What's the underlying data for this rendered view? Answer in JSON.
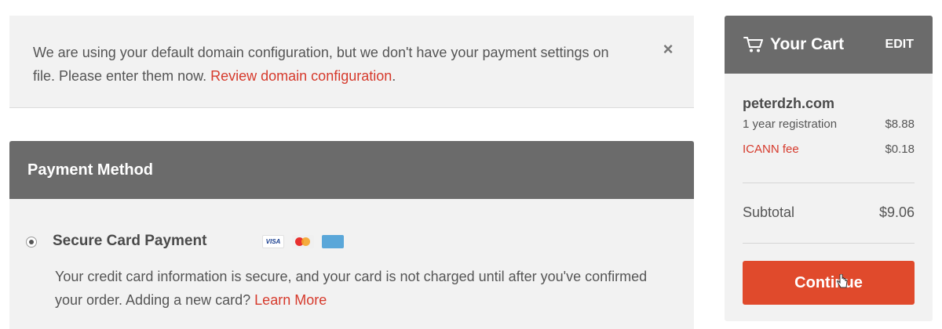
{
  "notice": {
    "text": "We are using your default domain configuration, but we don't have your payment settings on file. Please enter them now. ",
    "link": "Review domain configuration",
    "suffix": ".",
    "close": "×"
  },
  "payment": {
    "title": "Payment Method",
    "option_label": "Secure Card Payment",
    "cards": [
      "VISA",
      "MasterCard",
      "AMEX"
    ],
    "card_visa": "VISA",
    "card_amex": "AMEX",
    "description": "Your credit card information is secure, and your card is not charged until after you've confirmed your order. Adding a new card? ",
    "learn_more": "Learn More"
  },
  "cart": {
    "title": "Your Cart",
    "edit": "EDIT",
    "domain": "peterdzh.com",
    "items": [
      {
        "label": "1 year registration",
        "amount": "$8.88"
      },
      {
        "label": "ICANN fee",
        "amount": "$0.18"
      }
    ],
    "subtotal_label": "Subtotal",
    "subtotal_value": "$9.06",
    "continue": "Continue"
  },
  "colors": {
    "accent": "#d63a2c",
    "button": "#e04a2c",
    "header": "#6b6b6b",
    "panel": "#f2f2f2"
  }
}
